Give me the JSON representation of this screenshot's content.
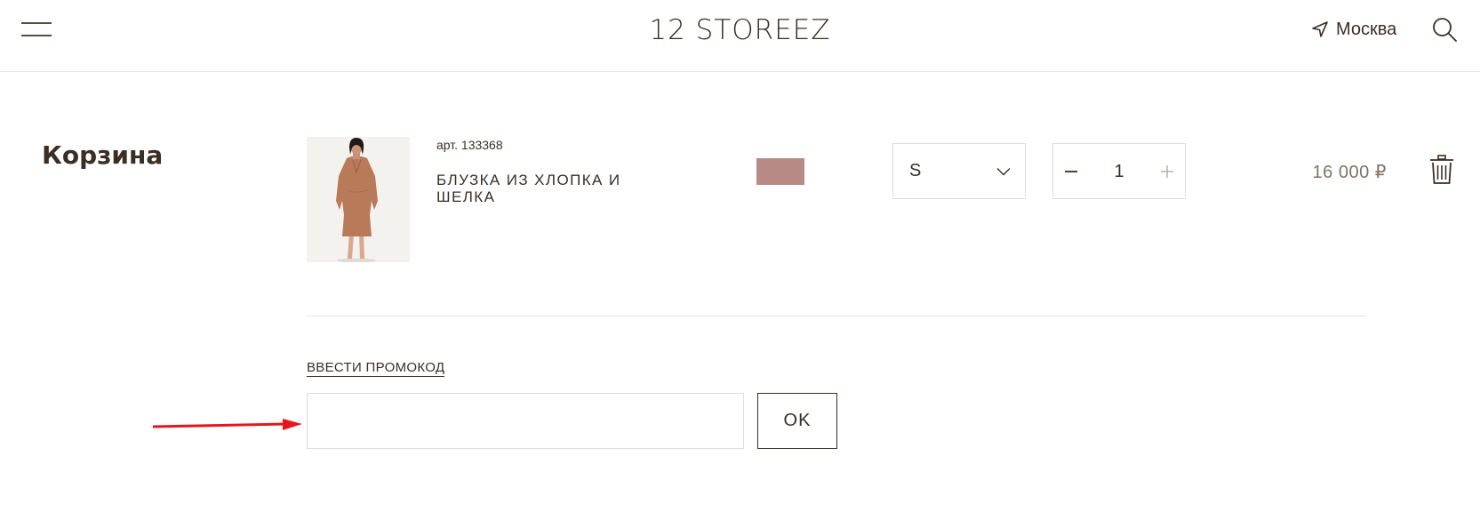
{
  "header": {
    "logo": "12 STOREEZ",
    "city": "Москва",
    "icons": {
      "menu": "burger-menu-icon",
      "location": "navigation-arrow-icon",
      "search": "search-icon"
    }
  },
  "cart": {
    "title": "Корзина",
    "items": [
      {
        "sku": "арт. 133368",
        "name": "БЛУЗКА ИЗ ХЛОПКА И ШЕЛКА",
        "color_hex": "#b88a86",
        "size": "S",
        "quantity": "1",
        "price": "16 000 ₽"
      }
    ]
  },
  "promo": {
    "link_label": "ВВЕСТИ ПРОМОКОД",
    "input_value": "",
    "ok_label": "OK"
  },
  "colors": {
    "text": "#3a2e25",
    "price": "#7f7267",
    "border": "#e1ddd9",
    "annotation": "#e8151b"
  }
}
